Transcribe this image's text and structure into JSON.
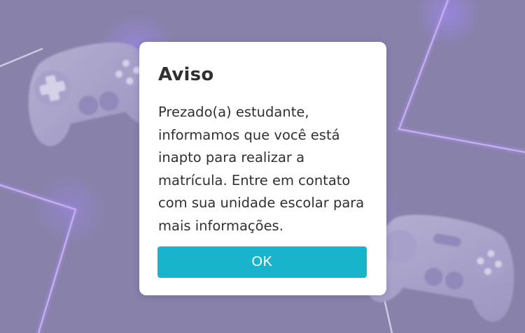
{
  "dialog": {
    "title": "Aviso",
    "message": "Prezado(a) estudante, informamos que você está inapto para realizar a matrícula. Entre em contato com sua unidade escolar para mais informações.",
    "ok_label": "OK"
  },
  "background": {
    "icon": "gamepad-icon",
    "color": "#8e88b0",
    "accent_color": "#c9a9ff"
  },
  "colors": {
    "button": "#17b4cb",
    "button_text": "#ffffff",
    "text": "#303030",
    "dialog": "#ffffff"
  }
}
